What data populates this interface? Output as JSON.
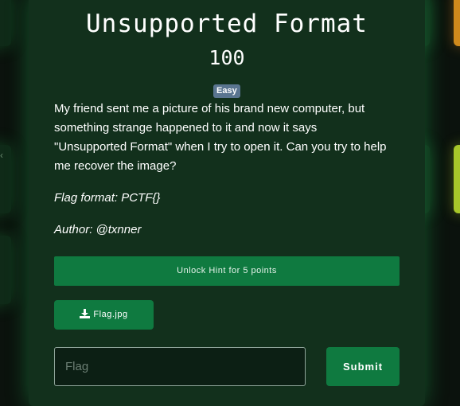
{
  "challenge": {
    "title": "Unsupported Format",
    "points": "100",
    "difficulty": "Easy",
    "description": "My friend sent me a picture of his brand new computer, but something strange happened to it and now it says \"Unsupported Format\" when I try to open it. Can you try to help me recover the image?",
    "flag_format": "Flag format: PCTF{}",
    "author": "Author: @txnner"
  },
  "hint": {
    "label": "Unlock Hint for 5 points"
  },
  "file": {
    "label": "Flag.jpg",
    "icon": "download-icon"
  },
  "flag_field": {
    "placeholder": "Flag",
    "value": ""
  },
  "submit": {
    "label": "Submit"
  },
  "colors": {
    "accent_green": "#0f7a40",
    "modal_bg": "#12301c",
    "badge_bg": "#5a7590",
    "card_orange": "#d08a1c",
    "card_lime": "#a7c72a"
  }
}
